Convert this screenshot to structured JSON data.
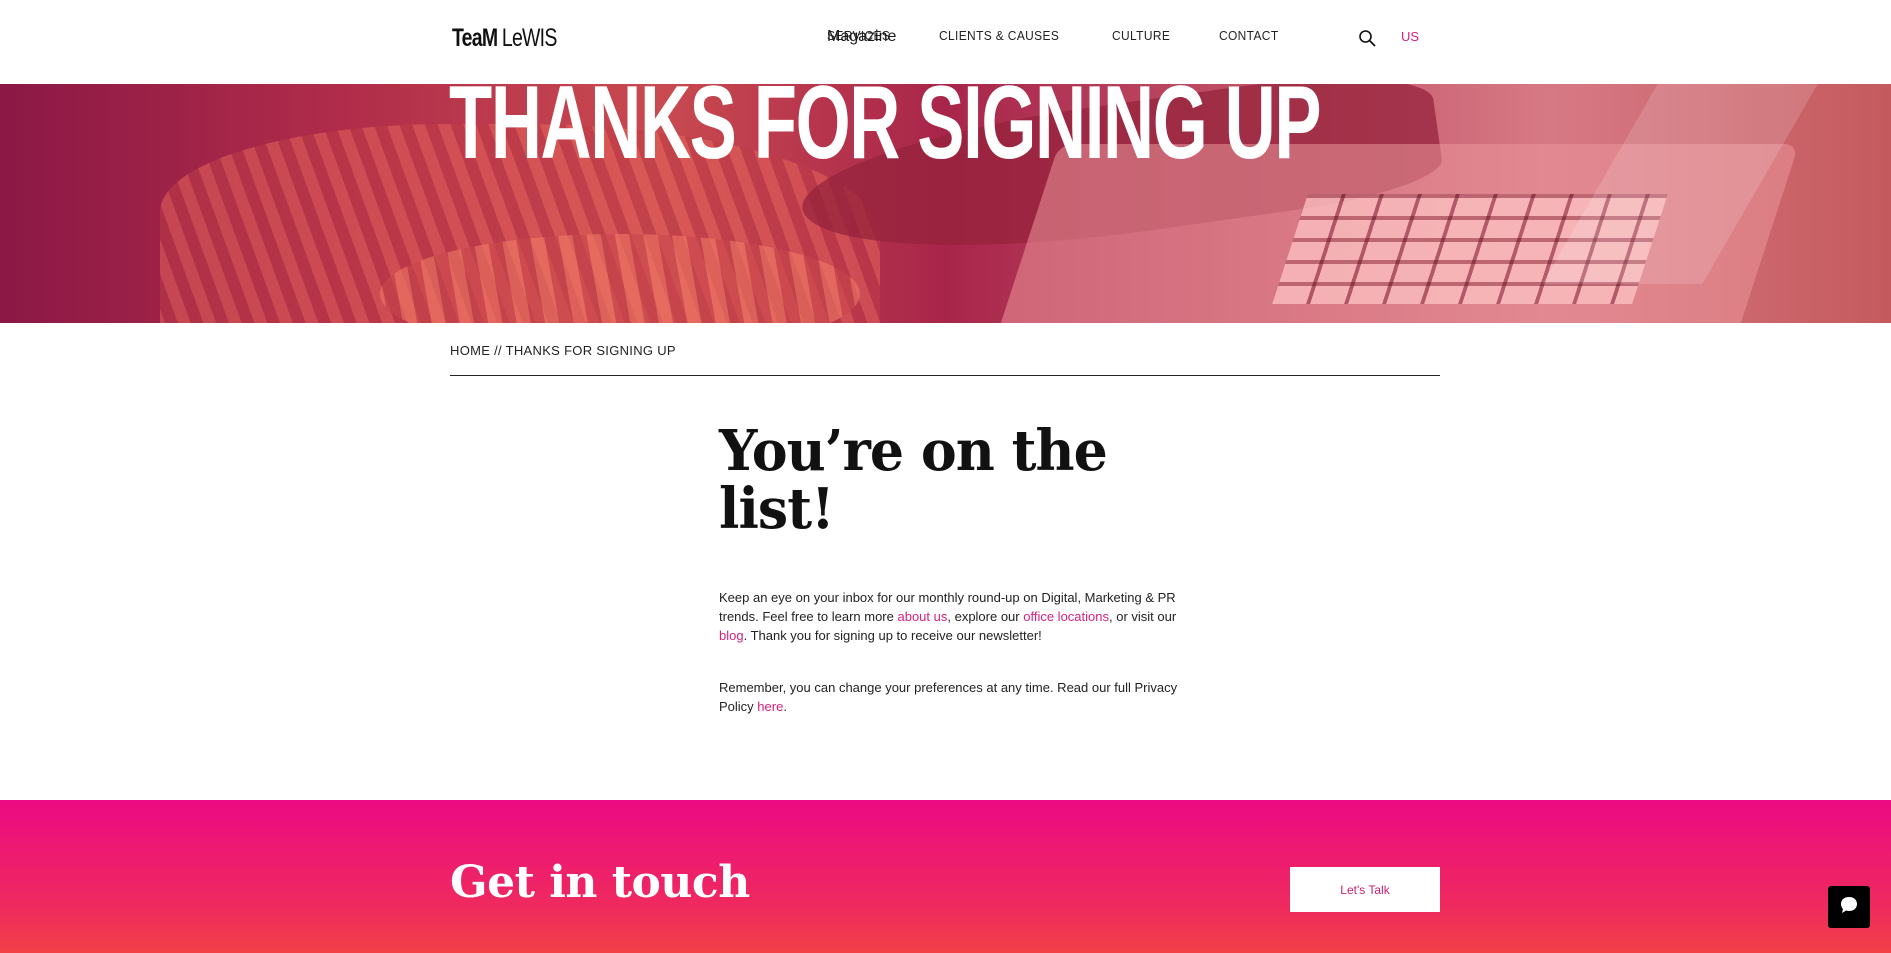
{
  "header": {
    "logo": {
      "part1": "TeaM",
      "part2": " LeWIS"
    },
    "nav": [
      {
        "label": "SERVICES"
      },
      {
        "label": "CLIENTS & CAUSES"
      },
      {
        "label": "CULTURE"
      },
      {
        "label": "CONTACT"
      }
    ],
    "magazine": "Magazine",
    "search_icon": "search-icon",
    "region": "US"
  },
  "hero": {
    "title": "THANKS FOR SIGNING UP"
  },
  "breadcrumb": {
    "home": "HOME",
    "separator": " // ",
    "current": "THANKS FOR SIGNING UP"
  },
  "main": {
    "title": "You’re on the list!",
    "para1": {
      "text_a": "Keep an eye on your inbox for our monthly round-up on Digital, Marketing & PR trends. Feel free to learn more ",
      "link_about": "about us",
      "text_b": ", explore our ",
      "link_offices": "office locations",
      "text_c": ", or visit our ",
      "link_blog": "blog",
      "text_d": ". Thank you for signing up to receive our newsletter!"
    },
    "para2": {
      "text_a": "Remember, you can change your preferences at any time. Read our full Privacy Policy ",
      "link_here": "here",
      "text_b": "."
    }
  },
  "cta": {
    "title": "Get in touch",
    "button": "Let's Talk"
  },
  "chat": {
    "icon": "chat-bubble-icon"
  },
  "colors": {
    "accent": "#d4227f",
    "cta_top": "#ec0a83",
    "cta_bottom": "#f24046"
  }
}
